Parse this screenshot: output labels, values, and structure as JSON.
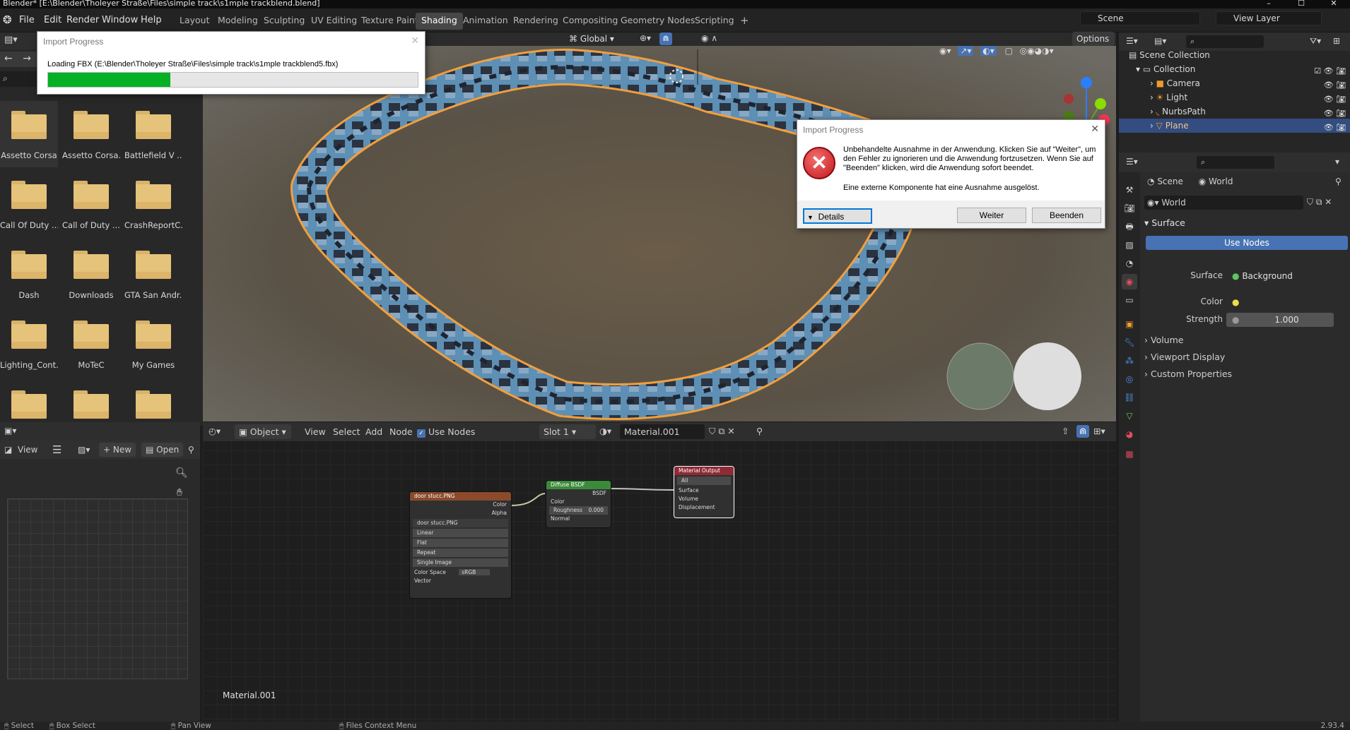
{
  "window": {
    "title": "Blender* [E:\\Blender\\Tholeyer Straße\\Files\\simple track\\s1mple trackblend.blend]",
    "minimize": "–",
    "maximize": "☐",
    "close": "✕"
  },
  "menu": [
    "File",
    "Edit",
    "Render",
    "Window",
    "Help"
  ],
  "workspaces": [
    "Layout",
    "Modeling",
    "Sculpting",
    "UV Editing",
    "Texture Paint",
    "Shading",
    "Animation",
    "Rendering",
    "Compositing",
    "Geometry Nodes",
    "Scripting"
  ],
  "active_workspace": "Shading",
  "scene": "Scene",
  "view_layer": "View Layer",
  "viewport_header": {
    "orientation": "Global",
    "options": "Options"
  },
  "file_browser": {
    "items": [
      "Assetto Corsa",
      "Assetto Corsa...",
      "Battlefield V ...",
      "Call Of Duty ...",
      "Call of Duty ...",
      "CrashReportC...",
      "Dash",
      "Downloads",
      "GTA San Andr...",
      "Lighting_Cont...",
      "MoTeC",
      "My Games",
      "",
      "",
      ""
    ]
  },
  "image_editor": {
    "view": "View",
    "new": "New",
    "open": "Open"
  },
  "node_editor": {
    "mode": "Object",
    "menus": [
      "View",
      "Select",
      "Add",
      "Node"
    ],
    "use_nodes": "Use Nodes",
    "slot": "Slot 1",
    "material": "Material.001",
    "footer_label": "Material.001",
    "nodes": {
      "image": {
        "title": "door stucc.PNG",
        "out_color": "Color",
        "out_alpha": "Alpha",
        "file": "door stucc.PNG",
        "interp": "Linear",
        "proj": "Flat",
        "ext": "Repeat",
        "source": "Single Image",
        "cs_label": "Color Space",
        "cs_value": "sRGB",
        "vector": "Vector"
      },
      "diffuse": {
        "title": "Diffuse BSDF",
        "out": "BSDF",
        "color": "Color",
        "roughness": "Roughness",
        "roughness_val": "0.000",
        "normal": "Normal"
      },
      "output": {
        "title": "Material Output",
        "target": "All",
        "surface": "Surface",
        "volume": "Volume",
        "displacement": "Displacement"
      }
    }
  },
  "outliner": {
    "root": "Scene Collection",
    "collection": "Collection",
    "objects": [
      "Camera",
      "Light",
      "NurbsPath",
      "Plane"
    ],
    "selected": "Plane"
  },
  "properties": {
    "breadcrumb_scene": "Scene",
    "breadcrumb_world": "World",
    "world_name": "World",
    "surface_panel": "Surface",
    "use_nodes": "Use Nodes",
    "surface_label": "Surface",
    "surface_value": "Background",
    "color_label": "Color",
    "strength_label": "Strength",
    "strength_value": "1.000",
    "panels": [
      "Volume",
      "Viewport Display",
      "Custom Properties"
    ]
  },
  "import_progress": {
    "caption": "Import Progress",
    "message": "Loading FBX (E:\\Blender\\Tholeyer Straße\\Files\\simple track\\s1mple trackblend5.fbx)",
    "progress": 0.33
  },
  "error_dialog": {
    "caption": "Import Progress",
    "message1": "Unbehandelte Ausnahme in der Anwendung. Klicken Sie auf \"Weiter\", um den Fehler zu ignorieren und die Anwendung fortzusetzen. Wenn Sie auf \"Beenden\" klicken, wird die Anwendung sofort beendet.",
    "message2": "Eine externe Komponente hat eine Ausnahme ausgelöst.",
    "details": "Details",
    "continue": "Weiter",
    "quit": "Beenden"
  },
  "status_bar": {
    "select": "Select",
    "box_select": "Box Select",
    "pan_view": "Pan View",
    "context_menu": "Files Context Menu",
    "version": "2.93.4"
  },
  "colors": {
    "accent": "#4772b3",
    "progress": "#06b025",
    "selection_outline": "#f29f3d"
  }
}
